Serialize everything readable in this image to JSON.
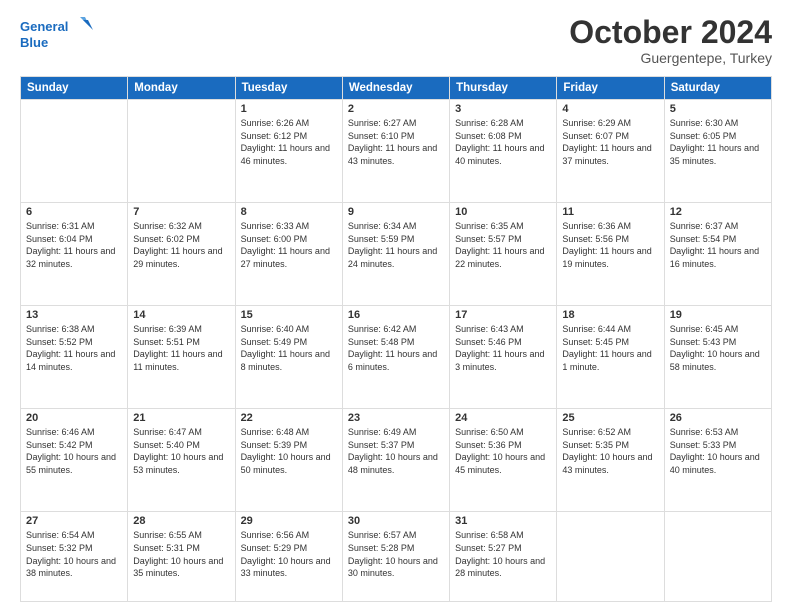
{
  "header": {
    "logo_line1": "General",
    "logo_line2": "Blue",
    "month": "October 2024",
    "location": "Guergentepe, Turkey"
  },
  "weekdays": [
    "Sunday",
    "Monday",
    "Tuesday",
    "Wednesday",
    "Thursday",
    "Friday",
    "Saturday"
  ],
  "weeks": [
    [
      {
        "day": "",
        "sunrise": "",
        "sunset": "",
        "daylight": ""
      },
      {
        "day": "",
        "sunrise": "",
        "sunset": "",
        "daylight": ""
      },
      {
        "day": "1",
        "sunrise": "Sunrise: 6:26 AM",
        "sunset": "Sunset: 6:12 PM",
        "daylight": "Daylight: 11 hours and 46 minutes."
      },
      {
        "day": "2",
        "sunrise": "Sunrise: 6:27 AM",
        "sunset": "Sunset: 6:10 PM",
        "daylight": "Daylight: 11 hours and 43 minutes."
      },
      {
        "day": "3",
        "sunrise": "Sunrise: 6:28 AM",
        "sunset": "Sunset: 6:08 PM",
        "daylight": "Daylight: 11 hours and 40 minutes."
      },
      {
        "day": "4",
        "sunrise": "Sunrise: 6:29 AM",
        "sunset": "Sunset: 6:07 PM",
        "daylight": "Daylight: 11 hours and 37 minutes."
      },
      {
        "day": "5",
        "sunrise": "Sunrise: 6:30 AM",
        "sunset": "Sunset: 6:05 PM",
        "daylight": "Daylight: 11 hours and 35 minutes."
      }
    ],
    [
      {
        "day": "6",
        "sunrise": "Sunrise: 6:31 AM",
        "sunset": "Sunset: 6:04 PM",
        "daylight": "Daylight: 11 hours and 32 minutes."
      },
      {
        "day": "7",
        "sunrise": "Sunrise: 6:32 AM",
        "sunset": "Sunset: 6:02 PM",
        "daylight": "Daylight: 11 hours and 29 minutes."
      },
      {
        "day": "8",
        "sunrise": "Sunrise: 6:33 AM",
        "sunset": "Sunset: 6:00 PM",
        "daylight": "Daylight: 11 hours and 27 minutes."
      },
      {
        "day": "9",
        "sunrise": "Sunrise: 6:34 AM",
        "sunset": "Sunset: 5:59 PM",
        "daylight": "Daylight: 11 hours and 24 minutes."
      },
      {
        "day": "10",
        "sunrise": "Sunrise: 6:35 AM",
        "sunset": "Sunset: 5:57 PM",
        "daylight": "Daylight: 11 hours and 22 minutes."
      },
      {
        "day": "11",
        "sunrise": "Sunrise: 6:36 AM",
        "sunset": "Sunset: 5:56 PM",
        "daylight": "Daylight: 11 hours and 19 minutes."
      },
      {
        "day": "12",
        "sunrise": "Sunrise: 6:37 AM",
        "sunset": "Sunset: 5:54 PM",
        "daylight": "Daylight: 11 hours and 16 minutes."
      }
    ],
    [
      {
        "day": "13",
        "sunrise": "Sunrise: 6:38 AM",
        "sunset": "Sunset: 5:52 PM",
        "daylight": "Daylight: 11 hours and 14 minutes."
      },
      {
        "day": "14",
        "sunrise": "Sunrise: 6:39 AM",
        "sunset": "Sunset: 5:51 PM",
        "daylight": "Daylight: 11 hours and 11 minutes."
      },
      {
        "day": "15",
        "sunrise": "Sunrise: 6:40 AM",
        "sunset": "Sunset: 5:49 PM",
        "daylight": "Daylight: 11 hours and 8 minutes."
      },
      {
        "day": "16",
        "sunrise": "Sunrise: 6:42 AM",
        "sunset": "Sunset: 5:48 PM",
        "daylight": "Daylight: 11 hours and 6 minutes."
      },
      {
        "day": "17",
        "sunrise": "Sunrise: 6:43 AM",
        "sunset": "Sunset: 5:46 PM",
        "daylight": "Daylight: 11 hours and 3 minutes."
      },
      {
        "day": "18",
        "sunrise": "Sunrise: 6:44 AM",
        "sunset": "Sunset: 5:45 PM",
        "daylight": "Daylight: 11 hours and 1 minute."
      },
      {
        "day": "19",
        "sunrise": "Sunrise: 6:45 AM",
        "sunset": "Sunset: 5:43 PM",
        "daylight": "Daylight: 10 hours and 58 minutes."
      }
    ],
    [
      {
        "day": "20",
        "sunrise": "Sunrise: 6:46 AM",
        "sunset": "Sunset: 5:42 PM",
        "daylight": "Daylight: 10 hours and 55 minutes."
      },
      {
        "day": "21",
        "sunrise": "Sunrise: 6:47 AM",
        "sunset": "Sunset: 5:40 PM",
        "daylight": "Daylight: 10 hours and 53 minutes."
      },
      {
        "day": "22",
        "sunrise": "Sunrise: 6:48 AM",
        "sunset": "Sunset: 5:39 PM",
        "daylight": "Daylight: 10 hours and 50 minutes."
      },
      {
        "day": "23",
        "sunrise": "Sunrise: 6:49 AM",
        "sunset": "Sunset: 5:37 PM",
        "daylight": "Daylight: 10 hours and 48 minutes."
      },
      {
        "day": "24",
        "sunrise": "Sunrise: 6:50 AM",
        "sunset": "Sunset: 5:36 PM",
        "daylight": "Daylight: 10 hours and 45 minutes."
      },
      {
        "day": "25",
        "sunrise": "Sunrise: 6:52 AM",
        "sunset": "Sunset: 5:35 PM",
        "daylight": "Daylight: 10 hours and 43 minutes."
      },
      {
        "day": "26",
        "sunrise": "Sunrise: 6:53 AM",
        "sunset": "Sunset: 5:33 PM",
        "daylight": "Daylight: 10 hours and 40 minutes."
      }
    ],
    [
      {
        "day": "27",
        "sunrise": "Sunrise: 6:54 AM",
        "sunset": "Sunset: 5:32 PM",
        "daylight": "Daylight: 10 hours and 38 minutes."
      },
      {
        "day": "28",
        "sunrise": "Sunrise: 6:55 AM",
        "sunset": "Sunset: 5:31 PM",
        "daylight": "Daylight: 10 hours and 35 minutes."
      },
      {
        "day": "29",
        "sunrise": "Sunrise: 6:56 AM",
        "sunset": "Sunset: 5:29 PM",
        "daylight": "Daylight: 10 hours and 33 minutes."
      },
      {
        "day": "30",
        "sunrise": "Sunrise: 6:57 AM",
        "sunset": "Sunset: 5:28 PM",
        "daylight": "Daylight: 10 hours and 30 minutes."
      },
      {
        "day": "31",
        "sunrise": "Sunrise: 6:58 AM",
        "sunset": "Sunset: 5:27 PM",
        "daylight": "Daylight: 10 hours and 28 minutes."
      },
      {
        "day": "",
        "sunrise": "",
        "sunset": "",
        "daylight": ""
      },
      {
        "day": "",
        "sunrise": "",
        "sunset": "",
        "daylight": ""
      }
    ]
  ]
}
